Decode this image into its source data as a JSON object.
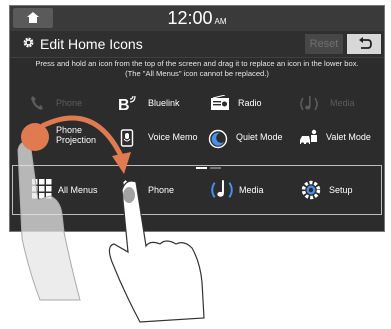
{
  "status": {
    "time": "12:00",
    "ampm": "AM"
  },
  "header": {
    "title": "Edit Home Icons",
    "reset_label": "Reset"
  },
  "instructions": "Press and hold an icon from the top of the screen and drag it to replace an icon in the lower box. (The \"All Menus\" icon cannot be replaced.)",
  "upper_icons": [
    {
      "label": "Phone",
      "icon": "phone-icon",
      "state": "disabled"
    },
    {
      "label": "Bluelink",
      "icon": "bluelink-icon"
    },
    {
      "label": "Radio",
      "icon": "radio-icon"
    },
    {
      "label": "Media",
      "icon": "media-icon",
      "state": "disabled"
    },
    {
      "label": "Phone Projection",
      "icon": "phone-projection-icon"
    },
    {
      "label": "Voice Memo",
      "icon": "voice-memo-icon"
    },
    {
      "label": "Quiet Mode",
      "icon": "quiet-mode-icon"
    },
    {
      "label": "Valet Mode",
      "icon": "valet-mode-icon"
    }
  ],
  "pager": {
    "pages": 2,
    "current": 1
  },
  "lower_icons": [
    {
      "label": "All Menus",
      "icon": "all-menus-icon"
    },
    {
      "label": "Phone",
      "icon": "phone-icon"
    },
    {
      "label": "Media",
      "icon": "media-icon"
    },
    {
      "label": "Setup",
      "icon": "setup-icon"
    }
  ],
  "colors": {
    "background": "#2c2c2c",
    "accent_drag": "#e07a50",
    "text": "#ffffff",
    "disabled_text": "#5c5c5c"
  }
}
